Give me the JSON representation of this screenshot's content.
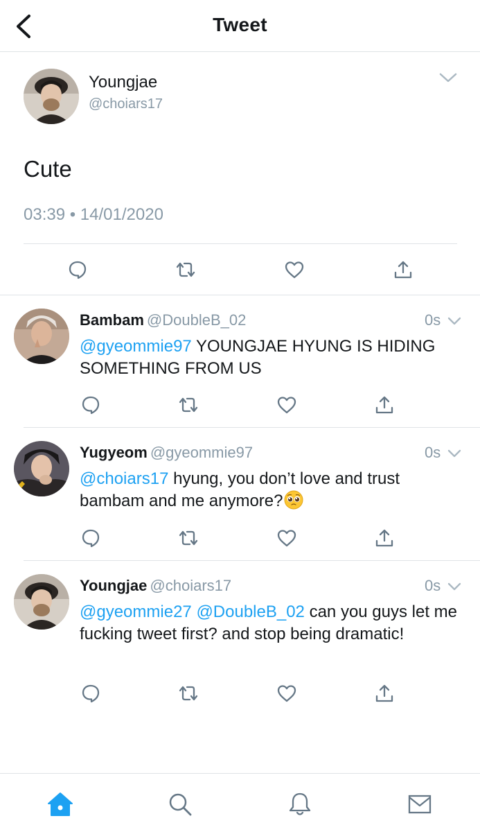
{
  "header": {
    "title": "Tweet"
  },
  "main_tweet": {
    "name": "Youngjae",
    "handle": "@choiars17",
    "text": "Cute",
    "timestamp": "03:39 • 14/01/2020"
  },
  "replies": [
    {
      "name": "Bambam",
      "handle": "@DoubleB_02",
      "time": "0s",
      "mention1": "@gyeommie97",
      "text": " YOUNGJAE HYUNG IS HIDING SOMETHING FROM US"
    },
    {
      "name": "Yugyeom",
      "handle": "@gyeommie97",
      "time": "0s",
      "mention1": "@choiars17",
      "text": " hyung, you don’t love and trust bambam and me anymore?"
    },
    {
      "name": "Youngjae",
      "handle": "@choiars17",
      "time": "0s",
      "mention1": "@gyeommie27",
      "mention2": "@DoubleB_02",
      "text": " can you  guys let me fucking tweet first? and stop being dramatic!"
    }
  ],
  "colors": {
    "accent": "#1da1f2",
    "secondary_text": "#8899a6",
    "divider": "#dfe3e6"
  },
  "icons": {
    "header": "back-arrow-icon",
    "actions": [
      "reply-icon",
      "retweet-icon",
      "like-icon",
      "share-icon"
    ],
    "tabs": [
      "home-icon",
      "search-icon",
      "notifications-icon",
      "messages-icon"
    ],
    "emoji": "pleading-face-emoji"
  }
}
